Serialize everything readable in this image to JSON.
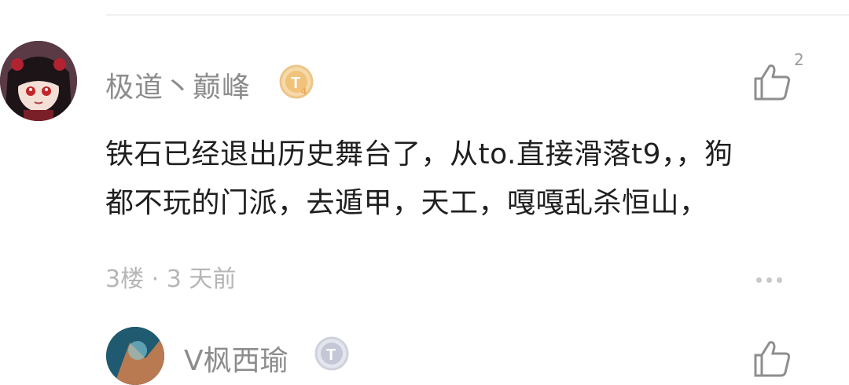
{
  "comment": {
    "username": "极道丶巅峰",
    "level_badge": "T4",
    "like_count": "2",
    "text_line1": "铁石已经退出历史舞台了，从to.直接滑落t9，，狗",
    "text_line2": "都不玩的门派，去遁甲，天工，嘎嘎乱杀恒山，",
    "floor": "3楼",
    "separator": "·",
    "time": "3 天前"
  },
  "next_comment": {
    "username": "V枫西瑜",
    "level_badge": "T"
  },
  "icons": {
    "like": "thumbs-up-icon",
    "more": "more-dots-icon"
  },
  "colors": {
    "username": "#8c8c8c",
    "text": "#1f1f1f",
    "meta": "#b6b6b6",
    "badge_gold": "#f0c27a"
  }
}
